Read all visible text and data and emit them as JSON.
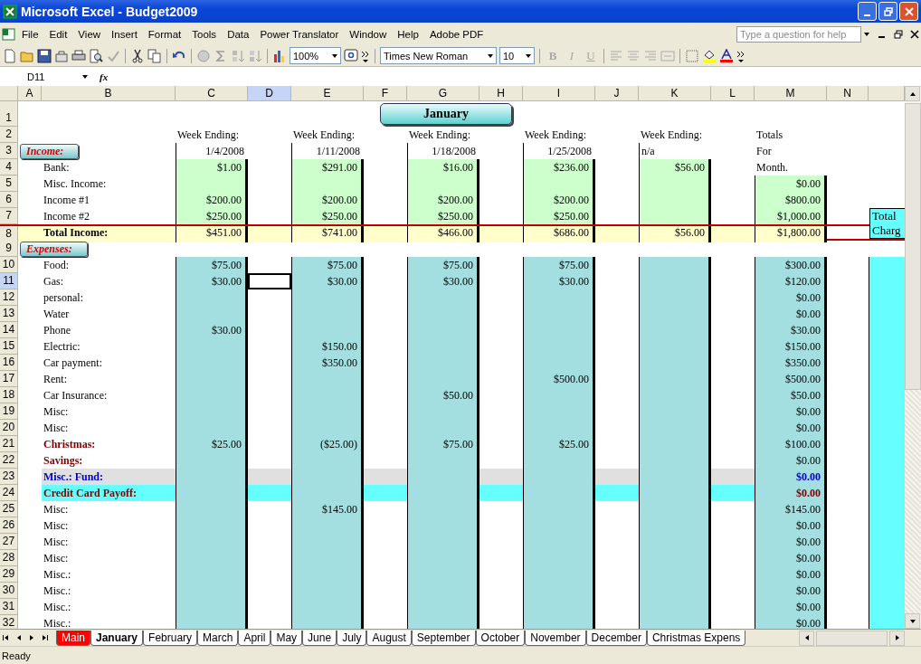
{
  "window": {
    "title": "Microsoft Excel - Budget2009"
  },
  "menu": [
    "File",
    "Edit",
    "View",
    "Insert",
    "Format",
    "Tools",
    "Data",
    "Power Translator",
    "Window",
    "Help",
    "Adobe PDF"
  ],
  "help_search": {
    "placeholder": "Type a question for help"
  },
  "toolbar": {
    "zoom": "100%",
    "font": "Times New Roman",
    "size": "10",
    "format_buttons": [
      {
        "label": "B",
        "disabled": true
      },
      {
        "label": "I",
        "disabled": true
      },
      {
        "label": "U",
        "disabled": true
      }
    ]
  },
  "formula_bar": {
    "name_box": "D11",
    "fx": "fx"
  },
  "columns": [
    {
      "label": "A",
      "selected": false
    },
    {
      "label": "B",
      "selected": false
    },
    {
      "label": "C",
      "selected": false
    },
    {
      "label": "D",
      "selected": true
    },
    {
      "label": "E",
      "selected": false
    },
    {
      "label": "F",
      "selected": false
    },
    {
      "label": "G",
      "selected": false
    },
    {
      "label": "H",
      "selected": false
    },
    {
      "label": "I",
      "selected": false
    },
    {
      "label": "J",
      "selected": false
    },
    {
      "label": "K",
      "selected": false
    },
    {
      "label": "L",
      "selected": false
    },
    {
      "label": "M",
      "selected": false
    },
    {
      "label": "N",
      "selected": false
    }
  ],
  "title_button": {
    "row": "1",
    "label": "January"
  },
  "rows": [
    {
      "num": "2",
      "kind": "header",
      "selected": false,
      "cells": [
        {
          "text": "Week Ending:",
          "kind": "text"
        },
        {
          "text": "Week Ending:",
          "kind": "text"
        },
        {
          "text": "Week Ending:",
          "kind": "text"
        },
        {
          "text": "Week Ending:",
          "kind": "text"
        },
        {
          "text": "Week Ending:",
          "kind": "text"
        }
      ],
      "total_label": "Totals"
    },
    {
      "num": "3",
      "kind": "header",
      "boxed": true,
      "selected": false,
      "section": "Income:",
      "cells": [
        {
          "text": "1/4/2008",
          "kind": "date"
        },
        {
          "text": "1/11/2008",
          "kind": "date"
        },
        {
          "text": "1/18/2008",
          "kind": "date"
        },
        {
          "text": "1/25/2008",
          "kind": "date"
        },
        {
          "text": "n/a",
          "kind": "text"
        }
      ],
      "total_label": "For"
    },
    {
      "num": "4",
      "kind": "income",
      "selected": false,
      "label": "Bank:",
      "cells": [
        "$1.00",
        "$291.00",
        "$16.00",
        "$236.00",
        "$56.00"
      ],
      "total_label": "Month."
    },
    {
      "num": "5",
      "kind": "income",
      "selected": false,
      "label": "Misc. Income:",
      "cells": [
        null,
        null,
        null,
        null,
        null,
        "$0.00"
      ]
    },
    {
      "num": "6",
      "kind": "income",
      "selected": false,
      "label": "Income #1",
      "cells": [
        "$200.00",
        "$200.00",
        "$200.00",
        "$200.00",
        null,
        "$800.00"
      ]
    },
    {
      "num": "7",
      "kind": "income",
      "selected": false,
      "label": "Income #2",
      "cells": [
        "$250.00",
        "$250.00",
        "$250.00",
        "$250.00",
        null,
        "$1,000.00"
      ],
      "side_note": "Total Charg"
    },
    {
      "num": "8",
      "kind": "total",
      "selected": false,
      "label": "Total Income:",
      "cells": [
        "$451.00",
        "$741.00",
        "$466.00",
        "$686.00",
        "$56.00",
        "$1,800.00"
      ]
    },
    {
      "num": "9",
      "kind": "spacer",
      "selected": false,
      "section": "Expenses:"
    },
    {
      "num": "10",
      "kind": "expense",
      "selected": false,
      "label": "Food:",
      "cells": [
        "$75.00",
        "$75.00",
        "$75.00",
        "$75.00",
        null,
        "$300.00"
      ]
    },
    {
      "num": "11",
      "kind": "expense",
      "selected": true,
      "label": "Gas:",
      "cells": [
        "$30.00",
        "$30.00",
        "$30.00",
        "$30.00",
        null,
        "$120.00"
      ]
    },
    {
      "num": "12",
      "kind": "expense",
      "selected": false,
      "label": "personal:",
      "cells": [
        null,
        null,
        null,
        null,
        null,
        "$0.00"
      ]
    },
    {
      "num": "13",
      "kind": "expense",
      "selected": false,
      "label": "Water",
      "cells": [
        null,
        null,
        null,
        null,
        null,
        "$0.00"
      ]
    },
    {
      "num": "14",
      "kind": "expense",
      "selected": false,
      "label": "Phone",
      "cells": [
        "$30.00",
        null,
        null,
        null,
        null,
        "$30.00"
      ]
    },
    {
      "num": "15",
      "kind": "expense",
      "selected": false,
      "label": "Electric:",
      "cells": [
        null,
        "$150.00",
        null,
        null,
        null,
        "$150.00"
      ]
    },
    {
      "num": "16",
      "kind": "expense",
      "selected": false,
      "label": "Car payment:",
      "cells": [
        null,
        "$350.00",
        null,
        null,
        null,
        "$350.00"
      ]
    },
    {
      "num": "17",
      "kind": "expense",
      "selected": false,
      "label": "Rent:",
      "cells": [
        null,
        null,
        null,
        "$500.00",
        null,
        "$500.00"
      ]
    },
    {
      "num": "18",
      "kind": "expense",
      "selected": false,
      "label": "Car Insurance:",
      "cells": [
        null,
        null,
        "$50.00",
        null,
        null,
        "$50.00"
      ]
    },
    {
      "num": "19",
      "kind": "expense",
      "selected": false,
      "label": "Misc:",
      "cells": [
        null,
        null,
        null,
        null,
        null,
        "$0.00"
      ]
    },
    {
      "num": "20",
      "kind": "expense",
      "selected": false,
      "label": "Misc:",
      "cells": [
        null,
        null,
        null,
        null,
        null,
        "$0.00"
      ]
    },
    {
      "num": "21",
      "kind": "fund",
      "selected": false,
      "label": "Christmas:",
      "cells": [
        "$25.00",
        "($25.00)",
        "$75.00",
        "$25.00",
        null,
        "$100.00"
      ]
    },
    {
      "num": "22",
      "kind": "fund",
      "selected": false,
      "label": "Savings:",
      "cells": [
        null,
        null,
        null,
        null,
        null,
        "$0.00"
      ]
    },
    {
      "num": "23",
      "kind": "misc-fund",
      "selected": false,
      "label": "Misc.: Fund:",
      "cells": [
        null,
        null,
        null,
        null,
        null,
        "$0.00"
      ]
    },
    {
      "num": "24",
      "kind": "payoff",
      "selected": false,
      "label": "Credit Card Payoff:",
      "cells": [
        null,
        null,
        null,
        null,
        null,
        "$0.00"
      ]
    },
    {
      "num": "25",
      "kind": "expense",
      "selected": false,
      "label": "Misc:",
      "cells": [
        null,
        "$145.00",
        null,
        null,
        null,
        "$145.00"
      ]
    },
    {
      "num": "26",
      "kind": "expense",
      "selected": false,
      "label": "Misc:",
      "cells": [
        null,
        null,
        null,
        null,
        null,
        "$0.00"
      ]
    },
    {
      "num": "27",
      "kind": "expense",
      "selected": false,
      "label": "Misc:",
      "cells": [
        null,
        null,
        null,
        null,
        null,
        "$0.00"
      ]
    },
    {
      "num": "28",
      "kind": "expense",
      "selected": false,
      "label": "Misc:",
      "cells": [
        null,
        null,
        null,
        null,
        null,
        "$0.00"
      ]
    },
    {
      "num": "29",
      "kind": "expense",
      "selected": false,
      "label": "Misc.:",
      "cells": [
        null,
        null,
        null,
        null,
        null,
        "$0.00"
      ]
    },
    {
      "num": "30",
      "kind": "expense",
      "selected": false,
      "label": "Misc.:",
      "cells": [
        null,
        null,
        null,
        null,
        null,
        "$0.00"
      ]
    },
    {
      "num": "31",
      "kind": "expense",
      "selected": false,
      "label": "Misc.:",
      "cells": [
        null,
        null,
        null,
        null,
        null,
        "$0.00"
      ]
    },
    {
      "num": "32",
      "kind": "expense",
      "selected": false,
      "label": "Misc.:",
      "cells": [
        null,
        null,
        null,
        null,
        null,
        "$0.00"
      ]
    }
  ],
  "sheet_tabs": [
    {
      "label": "Main",
      "selected": false,
      "color": "#ff0000"
    },
    {
      "label": "January",
      "selected": true
    },
    {
      "label": "February",
      "selected": false
    },
    {
      "label": "March",
      "selected": false
    },
    {
      "label": "April",
      "selected": false
    },
    {
      "label": "May",
      "selected": false
    },
    {
      "label": "June",
      "selected": false
    },
    {
      "label": "July",
      "selected": false
    },
    {
      "label": "August",
      "selected": false
    },
    {
      "label": "September",
      "selected": false
    },
    {
      "label": "October",
      "selected": false
    },
    {
      "label": "November",
      "selected": false
    },
    {
      "label": "December",
      "selected": false
    },
    {
      "label": "Christmas Expens",
      "selected": false
    }
  ],
  "status_bar": "Ready"
}
